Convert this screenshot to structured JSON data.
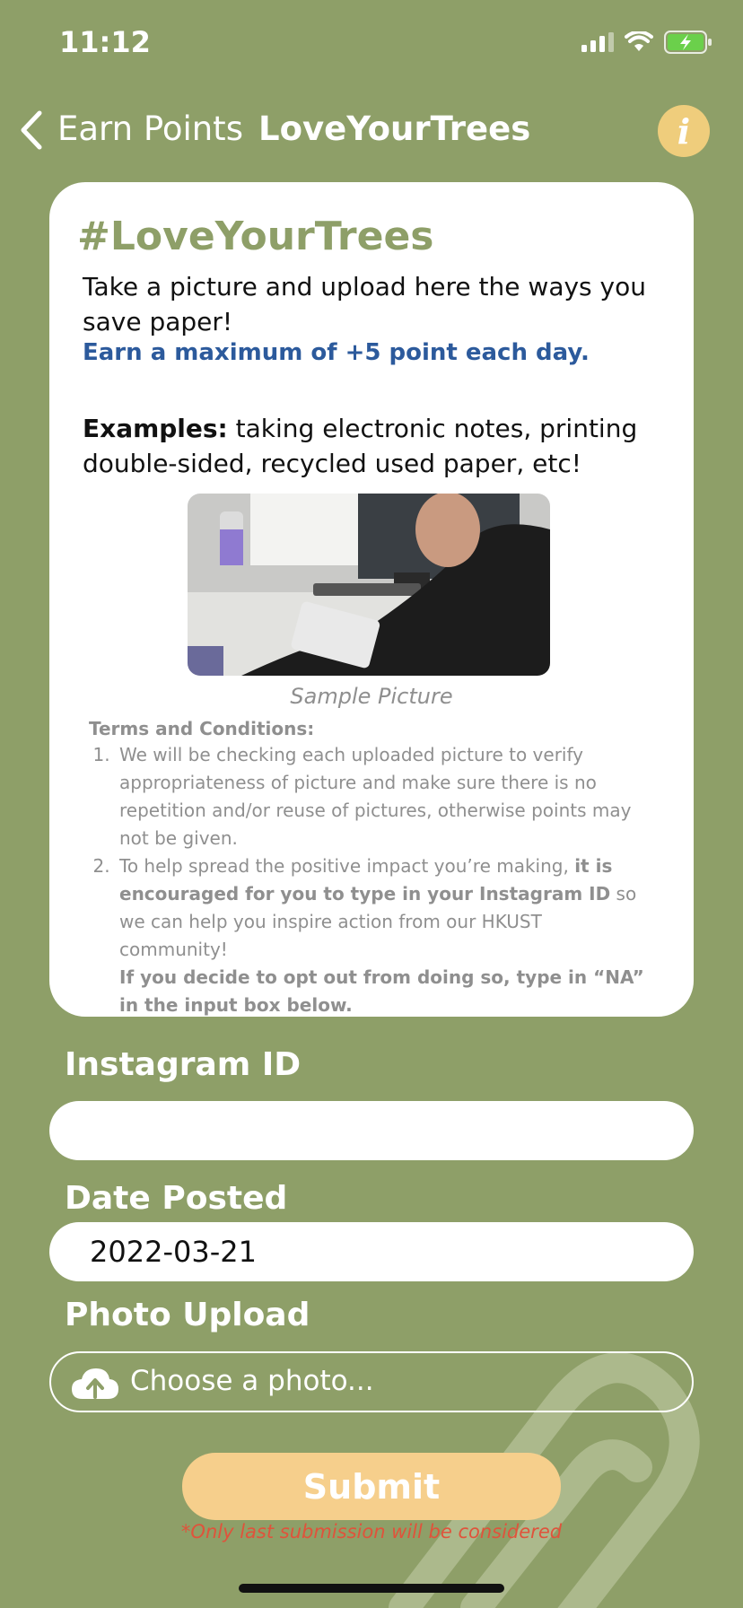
{
  "status_bar": {
    "time": "11:12"
  },
  "nav": {
    "back_label": "Earn Points",
    "title": "LoveYourTrees",
    "info_icon": "i"
  },
  "card": {
    "title": "#LoveYourTrees",
    "description": "Take a picture and upload here the ways you save paper!",
    "highlight": "Earn a maximum of +5 point each day.",
    "examples_label": "Examples:",
    "examples_text": " taking electronic notes, printing double-sided, recycled used paper, etc!",
    "photo_caption": "Sample Picture",
    "terms_title": "Terms and Conditions:",
    "term1": "We will be checking each uploaded picture to verify appropriateness of picture and make sure there is no repetition and/or reuse of pictures, otherwise points may not be given.",
    "term2_a": "To help spread the positive impact you’re making, ",
    "term2_b": "it is encouraged for you to type in your Instagram ID",
    "term2_c": " so we can help you inspire action from our HKUST community!",
    "term2_d": "If you decide to opt out from doing so, type in “NA” in the input box below."
  },
  "form": {
    "instagram_label": "Instagram ID",
    "instagram_value": "",
    "date_label": "Date Posted",
    "date_value": "2022-03-21",
    "photo_label": "Photo Upload",
    "photo_placeholder": "Choose a photo...",
    "submit_label": "Submit",
    "note": "*Only last submission will be considered"
  },
  "colors": {
    "background": "#8e9f68",
    "title_green": "#8e9f68",
    "highlight_blue": "#2c5a9c",
    "submit": "#f6cf8c",
    "info": "#efcd7c",
    "note_red": "#e0533b"
  },
  "icons": [
    "chevron-left-icon",
    "info-icon",
    "signal-icon",
    "wifi-icon",
    "battery-charging-icon",
    "cloud-upload-icon",
    "paperclip-watermark"
  ]
}
